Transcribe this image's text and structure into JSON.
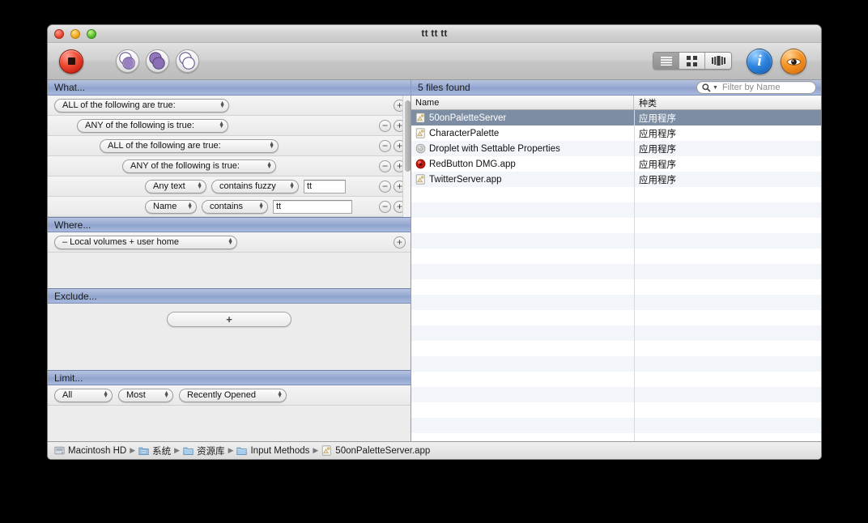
{
  "window": {
    "title": "tt tt tt"
  },
  "toolbar": {
    "stop_label": "stop-record",
    "venn": [
      {
        "name": "venn-intersect",
        "label": "Intersect"
      },
      {
        "name": "venn-union",
        "label": "Union"
      },
      {
        "name": "venn-difference",
        "label": "Difference"
      }
    ],
    "view_segments": [
      {
        "name": "view-list",
        "label": "List view",
        "active": true
      },
      {
        "name": "view-icon",
        "label": "Icon view",
        "active": false
      },
      {
        "name": "view-coverflow",
        "label": "Cover Flow view",
        "active": false
      }
    ],
    "info_label": "i",
    "eye_label": "Quick Look"
  },
  "sections": {
    "what": "What...",
    "where": "Where...",
    "exclude": "Exclude...",
    "limit": "Limit..."
  },
  "what_rows": [
    {
      "indent": 0,
      "popups": [
        "ALL of the following are true:"
      ],
      "popup_widths": [
        216
      ],
      "field": null,
      "minus": false,
      "plus": true
    },
    {
      "indent": 1,
      "popups": [
        "ANY of the following is true:"
      ],
      "popup_widths": [
        187
      ],
      "field": null,
      "minus": true,
      "plus": true
    },
    {
      "indent": 2,
      "popups": [
        "ALL of the following are true:"
      ],
      "popup_widths": [
        221
      ],
      "field": null,
      "minus": true,
      "plus": true
    },
    {
      "indent": 3,
      "popups": [
        "ANY of the following is true:"
      ],
      "popup_widths": [
        190
      ],
      "field": null,
      "minus": true,
      "plus": true
    },
    {
      "indent": 4,
      "popups": [
        "Any text",
        "contains fuzzy"
      ],
      "popup_widths": [
        76,
        108
      ],
      "field": "tt",
      "field_width": 52,
      "minus": true,
      "plus": true
    },
    {
      "indent": 4,
      "popups": [
        "Name",
        "contains"
      ],
      "popup_widths": [
        64,
        82
      ],
      "field": "tt",
      "field_width": 98,
      "minus": true,
      "plus": true
    }
  ],
  "where": {
    "scope": "– Local volumes + user home",
    "plus": "+"
  },
  "exclude": {
    "add_label": "+"
  },
  "limit": {
    "count": "All",
    "rank": "Most",
    "criterion": "Recently Opened"
  },
  "results": {
    "status": "5 files found",
    "filter_placeholder": "Filter by Name",
    "columns": [
      "Name",
      "种类"
    ],
    "rows": [
      {
        "name": "50onPaletteServer",
        "kind": "应用程序",
        "icon": "applescript-icon",
        "selected": true
      },
      {
        "name": "CharacterPalette",
        "kind": "应用程序",
        "icon": "applescript-icon",
        "selected": false
      },
      {
        "name": "Droplet with Settable Properties",
        "kind": "应用程序",
        "icon": "droplet-icon",
        "selected": false
      },
      {
        "name": "RedButton DMG.app",
        "kind": "应用程序",
        "icon": "red-sphere-icon",
        "selected": false
      },
      {
        "name": "TwitterServer.app",
        "kind": "应用程序",
        "icon": "applescript-icon",
        "selected": false
      }
    ],
    "empty_row_count": 16
  },
  "pathbar": [
    {
      "label": "Macintosh HD",
      "icon": "harddisk-icon"
    },
    {
      "label": "系统",
      "icon": "system-folder-icon"
    },
    {
      "label": "资源库",
      "icon": "folder-icon"
    },
    {
      "label": "Input Methods",
      "icon": "folder-icon"
    },
    {
      "label": "50onPaletteServer.app",
      "icon": "applescript-icon"
    }
  ],
  "colors": {
    "section_header": "#97a9d2",
    "selection": "#7d8ea4",
    "stripe": "#f2f5fa",
    "accent_purple": "#7b5ea7",
    "info_blue": "#2f86e0",
    "eye_orange": "#f59322"
  }
}
